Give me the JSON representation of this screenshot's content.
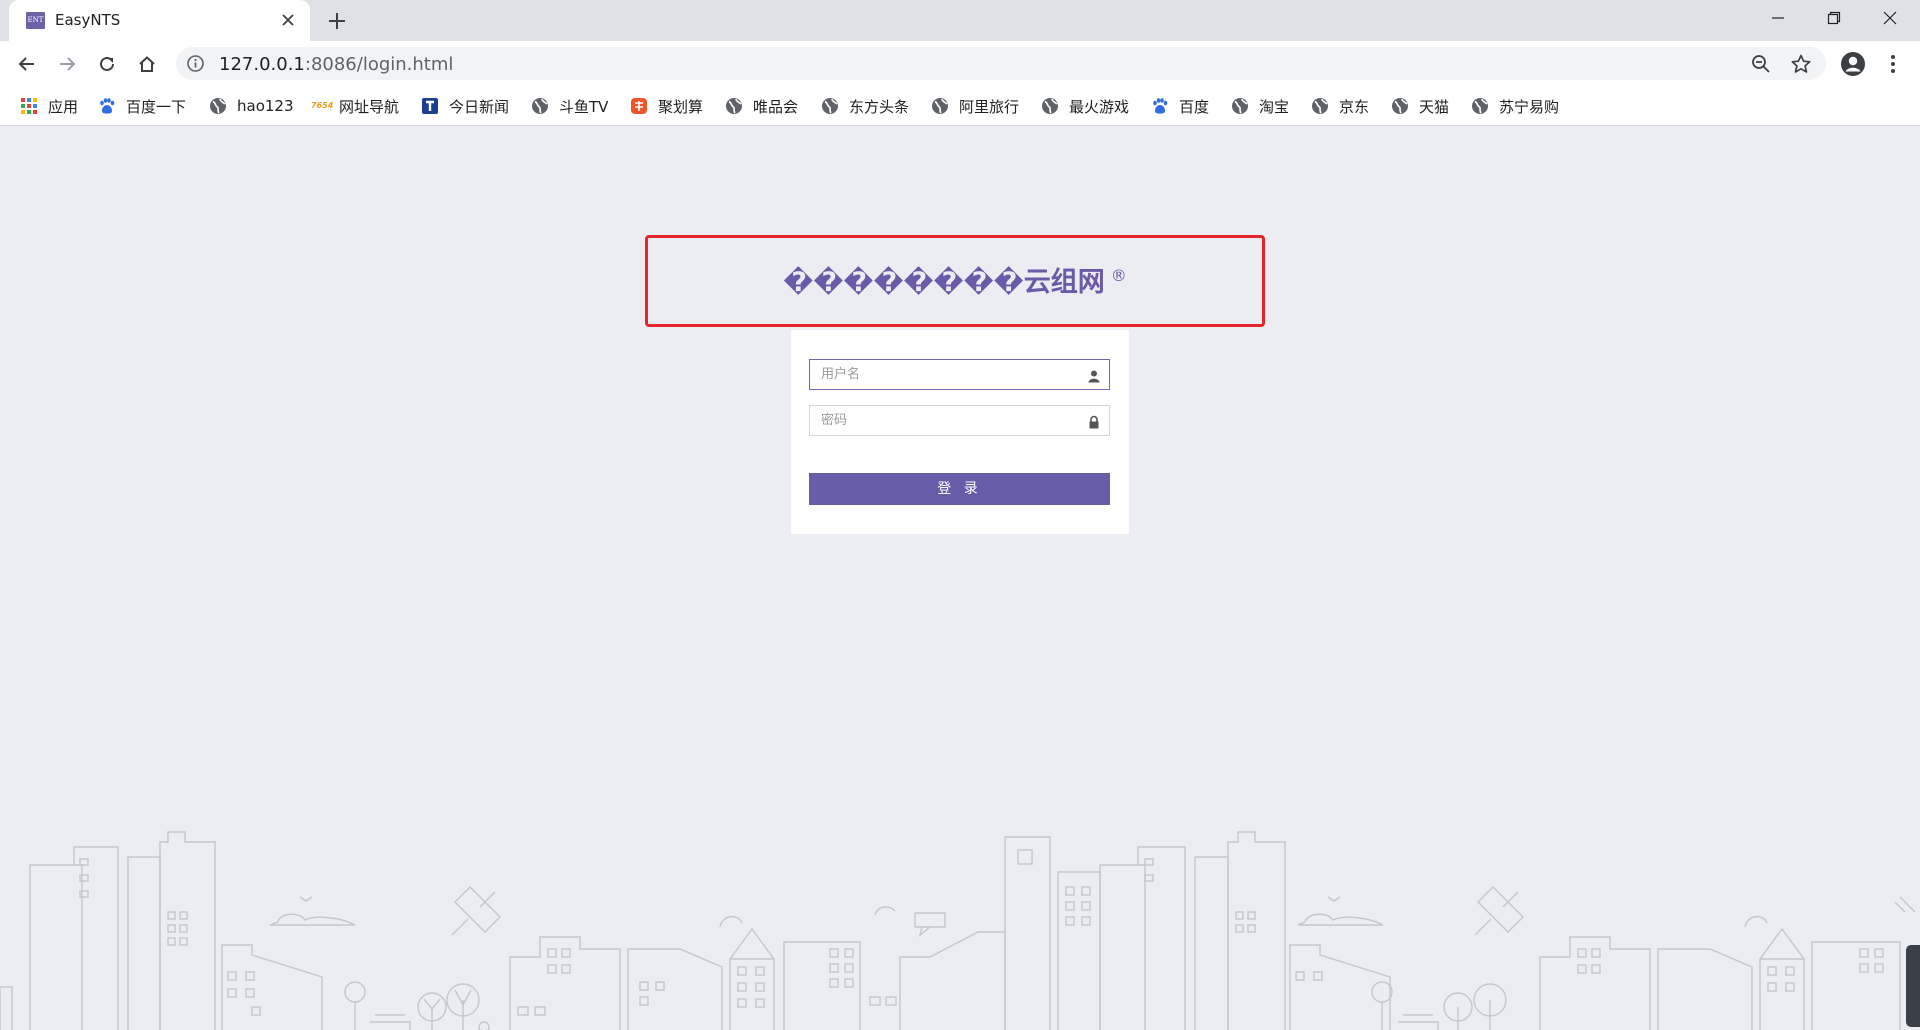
{
  "tab": {
    "title": "EasyNTS",
    "favicon_text": "ENT"
  },
  "address_bar": {
    "host": "127.0.0.1",
    "path": ":8086/login.html"
  },
  "bookmarks": [
    {
      "label": "应用",
      "icon": "apps-grid-icon"
    },
    {
      "label": "百度一下",
      "icon": "baidu-paw-icon"
    },
    {
      "label": "hao123",
      "icon": "globe-icon"
    },
    {
      "label": "网址导航",
      "icon": "7654-icon",
      "icon_text": "7654"
    },
    {
      "label": "今日新闻",
      "icon": "news-icon"
    },
    {
      "label": "斗鱼TV",
      "icon": "globe-icon"
    },
    {
      "label": "聚划算",
      "icon": "juhuasuan-icon"
    },
    {
      "label": "唯品会",
      "icon": "globe-icon"
    },
    {
      "label": "东方头条",
      "icon": "globe-icon"
    },
    {
      "label": "阿里旅行",
      "icon": "globe-icon"
    },
    {
      "label": "最火游戏",
      "icon": "globe-icon"
    },
    {
      "label": "百度",
      "icon": "baidu-paw-icon"
    },
    {
      "label": "淘宝",
      "icon": "globe-icon"
    },
    {
      "label": "京东",
      "icon": "globe-icon"
    },
    {
      "label": "天猫",
      "icon": "globe-icon"
    },
    {
      "label": "苏宁易购",
      "icon": "globe-icon"
    }
  ],
  "login": {
    "title": "��������云组网",
    "registered_mark": "®",
    "username_placeholder": "用户名",
    "password_placeholder": "密码",
    "submit_label": "登 录"
  },
  "colors": {
    "accent": "#675ca8",
    "title": "#6a5aa8",
    "highlight_border": "#e4252a",
    "page_background": "#ebedf2"
  }
}
